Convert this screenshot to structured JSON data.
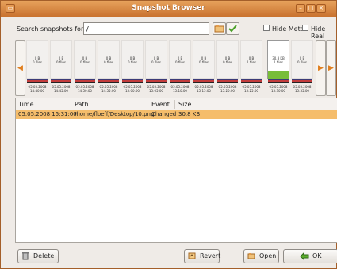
{
  "window": {
    "title": "Snapshot Browser"
  },
  "search": {
    "label": "Search snapshots for:",
    "value": "/"
  },
  "checkboxes": {
    "hide_meta": "Hide Meta",
    "hide_real": "Hide Real"
  },
  "snapshots": [
    {
      "size": "0 B",
      "files": "0 files",
      "date": "05.05.2008",
      "time": "14:40:00"
    },
    {
      "size": "0 B",
      "files": "0 files",
      "date": "05.05.2008",
      "time": "14:45:00"
    },
    {
      "size": "0 B",
      "files": "0 files",
      "date": "05.05.2008",
      "time": "14:50:00"
    },
    {
      "size": "0 B",
      "files": "0 files",
      "date": "05.05.2008",
      "time": "14:55:00"
    },
    {
      "size": "0 B",
      "files": "0 files",
      "date": "05.05.2008",
      "time": "15:00:00"
    },
    {
      "size": "0 B",
      "files": "0 files",
      "date": "05.05.2008",
      "time": "15:05:00"
    },
    {
      "size": "0 B",
      "files": "0 files",
      "date": "05.05.2008",
      "time": "15:10:00"
    },
    {
      "size": "0 B",
      "files": "0 files",
      "date": "05.05.2008",
      "time": "15:15:00"
    },
    {
      "size": "0 B",
      "files": "0 files",
      "date": "05.05.2008",
      "time": "15:20:00"
    },
    {
      "size": "0 B",
      "files": "1 files",
      "date": "05.05.2008",
      "time": "15:25:00"
    },
    {
      "size": "30.8 KB",
      "files": "1 files",
      "date": "05.05.2008",
      "time": "15:30:00"
    },
    {
      "size": "0 B",
      "files": "0 files",
      "date": "05.05.2008",
      "time": "15:35:00"
    }
  ],
  "table": {
    "headers": [
      "Time",
      "Path",
      "Event",
      "Size"
    ],
    "rows": [
      {
        "time": "05.05.2008 15:31:00",
        "path": "/home/floeff/Desktop/10.png",
        "event": "Changed",
        "size": "30.8 KB"
      }
    ]
  },
  "buttons": {
    "delete": "Delete",
    "revert": "Revert",
    "open": "Open",
    "ok": "OK"
  },
  "colors": {
    "accent": "#f5bd6b",
    "titlebar": "#d27e35"
  },
  "icons": {
    "folder": "folder-icon",
    "apply": "check-icon",
    "trash": "trash-icon",
    "revert": "revert-icon",
    "open": "open-icon",
    "ok": "ok-arrow-icon"
  }
}
